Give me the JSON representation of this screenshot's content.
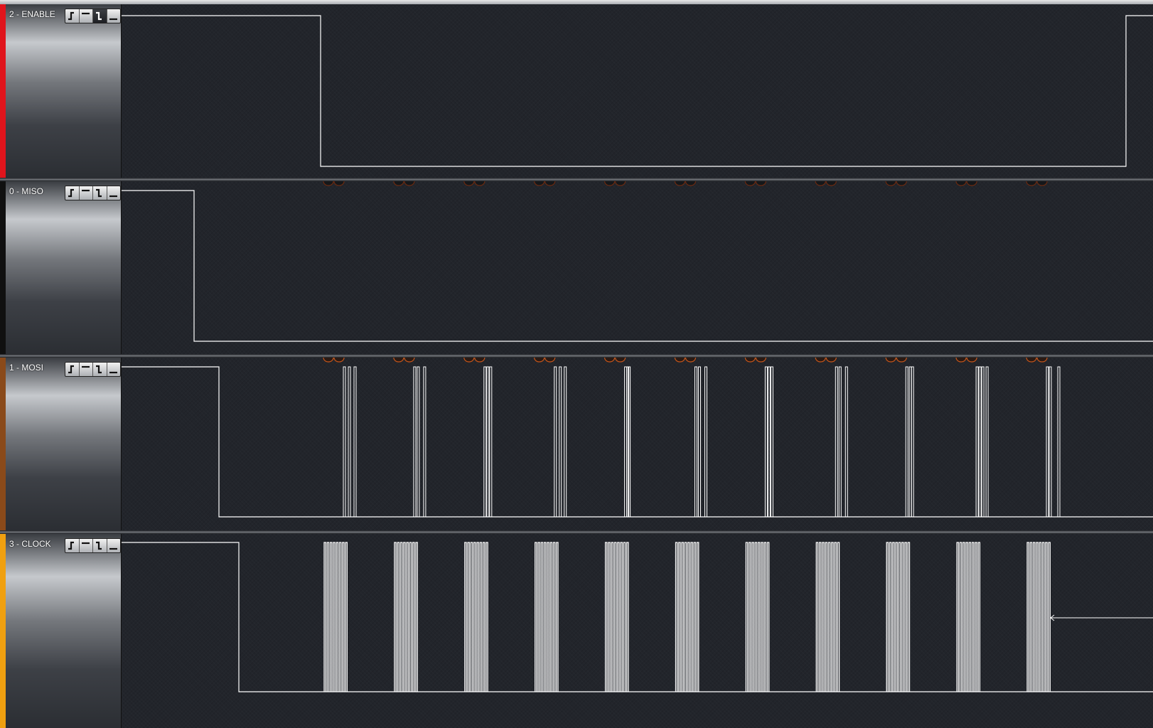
{
  "channels": [
    {
      "name": "2 - ENABLE",
      "color": "#e0141c",
      "active_trigger": 2,
      "triggers": [
        {
          "name": "rising-edge-trigger-icon"
        },
        {
          "name": "high-level-trigger-icon"
        },
        {
          "name": "falling-edge-trigger-icon"
        },
        {
          "name": "low-level-trigger-icon"
        }
      ]
    },
    {
      "name": "0 - MISO",
      "color": "#101010",
      "active_trigger": -1,
      "triggers": [
        {
          "name": "rising-edge-trigger-icon"
        },
        {
          "name": "high-level-trigger-icon"
        },
        {
          "name": "falling-edge-trigger-icon"
        },
        {
          "name": "low-level-trigger-icon"
        }
      ]
    },
    {
      "name": "1 - MOSI",
      "color": "#8a4a1a",
      "active_trigger": -1,
      "triggers": [
        {
          "name": "rising-edge-trigger-icon"
        },
        {
          "name": "high-level-trigger-icon"
        },
        {
          "name": "falling-edge-trigger-icon"
        },
        {
          "name": "low-level-trigger-icon"
        }
      ]
    },
    {
      "name": "3 - CLOCK",
      "color": "#f0a010",
      "active_trigger": -1,
      "triggers": [
        {
          "name": "rising-edge-trigger-icon"
        },
        {
          "name": "high-level-trigger-icon"
        },
        {
          "name": "falling-edge-trigger-icon"
        },
        {
          "name": "low-level-trigger-icon"
        }
      ]
    }
  ],
  "colors": {
    "background": "#202329",
    "waveform": "#ffffff",
    "byte_marker_miso": "#6b2a10",
    "byte_marker_mosi": "#c2541a"
  },
  "byte_count": 11
}
